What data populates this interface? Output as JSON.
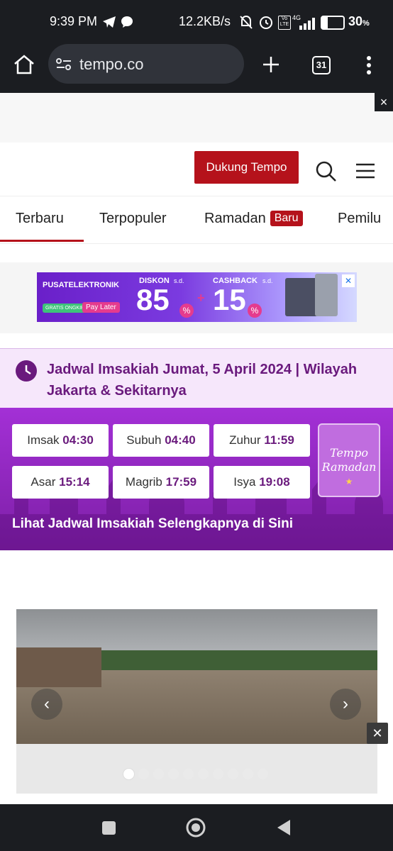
{
  "status_bar": {
    "time": "9:39 PM",
    "speed": "12.2KB/s",
    "battery": "30",
    "battery_unit": "%",
    "network": "4G"
  },
  "browser": {
    "url": "tempo.co",
    "tab_count": "31",
    "icons": [
      "home-icon",
      "site-settings-icon",
      "new-tab-icon",
      "tab-switcher-icon",
      "menu-icon"
    ]
  },
  "ad_close_label": "×",
  "header": {
    "support_button": "Dukung Tempo",
    "icons": [
      "search-icon",
      "hamburger-menu-icon"
    ]
  },
  "nav": {
    "tabs": [
      {
        "label": "Terbaru"
      },
      {
        "label": "Terpopuler"
      },
      {
        "label": "Ramadan",
        "badge": "Baru"
      },
      {
        "label": "Pemilu"
      }
    ]
  },
  "banner_ad": {
    "brand": "PUSATELEKTRONIK",
    "tags": [
      "GRATIS ONGKIR",
      "Pay Later"
    ],
    "diskon_label": "DISKON",
    "diskon_value": "85",
    "cashback_label": "CASHBACK",
    "cashback_value": "15",
    "sd": "s.d.",
    "percent": "%",
    "plus": "+",
    "close": "✕"
  },
  "imsakiah": {
    "title": "Jadwal Imsakiah Jumat, 5 April 2024 | Wilayah Jakarta & Sekitarnya",
    "times": [
      {
        "name": "Imsak",
        "time": "04:30"
      },
      {
        "name": "Subuh",
        "time": "04:40"
      },
      {
        "name": "Zuhur",
        "time": "11:59"
      },
      {
        "name": "Asar",
        "time": "15:14"
      },
      {
        "name": "Magrib",
        "time": "17:59"
      },
      {
        "name": "Isya",
        "time": "19:08"
      }
    ],
    "badge_line1": "Tempo",
    "badge_line2": "Ramadan",
    "link": "Lihat Jadwal Imsakiah Selengkapnya di Sini"
  },
  "slider": {
    "prev": "‹",
    "next": "›",
    "slide_count": 10,
    "active_index": 0,
    "close": "✕"
  },
  "colors": {
    "brand_red": "#b5121b",
    "ramadan_purple": "#6a1a7d"
  }
}
